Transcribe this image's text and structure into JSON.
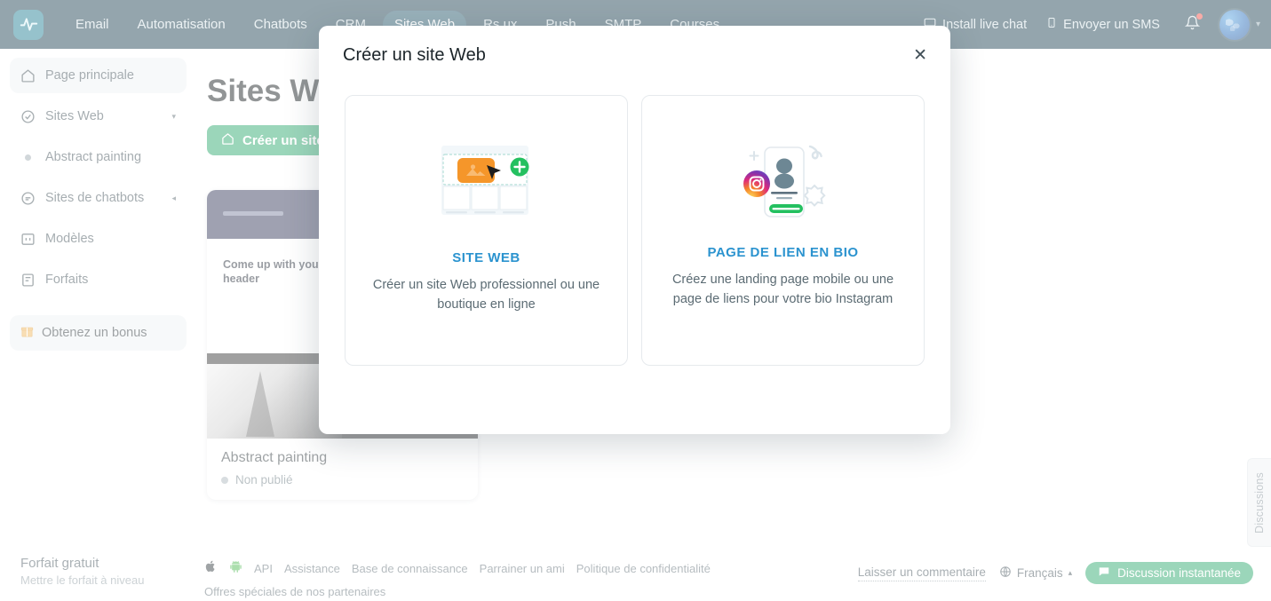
{
  "topnav": {
    "logo_icon": "activity-pulse-logo",
    "items": [
      {
        "label": "Email",
        "active": false
      },
      {
        "label": "Automatisation",
        "active": false
      },
      {
        "label": "Chatbots",
        "active": false
      },
      {
        "label": "CRM",
        "active": false
      },
      {
        "label": "Sites Web",
        "active": true
      },
      {
        "label": "Rs ux",
        "active": false
      },
      {
        "label": "Push",
        "active": false
      },
      {
        "label": "SMTP",
        "active": false
      },
      {
        "label": "Courses",
        "active": false
      }
    ],
    "install_live_chat": "Install live chat",
    "send_sms": "Envoyer un SMS",
    "bell_icon": "notification-bell-icon",
    "avatar_icon": "user-avatar",
    "caret": "▾"
  },
  "sidebar": {
    "items": [
      {
        "label": "Page principale",
        "icon": "home-icon",
        "active": true,
        "caret": ""
      },
      {
        "label": "Sites Web",
        "icon": "check-badge-icon",
        "active": false,
        "caret": "▾"
      },
      {
        "label": "Abstract painting",
        "icon": "dot-icon",
        "active": false,
        "caret": ""
      },
      {
        "label": "Sites de chatbots",
        "icon": "chat-bubble-icon",
        "active": false,
        "caret": "◂"
      },
      {
        "label": "Modèles",
        "icon": "template-icon",
        "active": false,
        "caret": ""
      },
      {
        "label": "Forfaits",
        "icon": "plans-icon",
        "active": false,
        "caret": ""
      }
    ],
    "bonus_label": "Obtenez un bonus",
    "bonus_icon": "gift-icon",
    "plan_title": "Forfait gratuit",
    "plan_sub": "Mettre le forfait à niveau"
  },
  "main": {
    "page_title": "Sites Web",
    "create_button": "Créer un site Web",
    "create_button_icon": "home-icon",
    "collapse_icon": "chevron-left-icon",
    "site_card": {
      "thumb_header_text": "Come up with your own header",
      "thumb_photo_title": "Come up",
      "name": "Abstract painting",
      "status": "Non publié"
    }
  },
  "modal": {
    "title": "Créer un site Web",
    "close_icon": "close-icon",
    "options": [
      {
        "title": "SITE WEB",
        "desc": "Créer un site Web professionnel ou une boutique en ligne",
        "illustration": "website-builder-illustration"
      },
      {
        "title": "PAGE DE LIEN EN BIO",
        "desc": "Créez une landing page mobile ou une page de liens pour votre bio Instagram",
        "illustration": "bio-link-page-illustration"
      }
    ]
  },
  "footer": {
    "apple_icon": "apple-icon",
    "android_icon": "android-icon",
    "links": [
      "API",
      "Assistance",
      "Base de connaissance",
      "Parrainer un ami",
      "Politique de confidentialité"
    ],
    "partners": "Offres spéciales de nos partenaires",
    "comment_link": "Laisser un commentaire",
    "language": "Français",
    "language_icon": "globe-icon",
    "language_caret": "▴",
    "chat_button": "Discussion instantanée",
    "chat_button_icon": "chat-icon",
    "discussions_tab": "Discussions"
  },
  "colors": {
    "navbar": "#12394a",
    "nav_active": "#1d5267",
    "accent_green": "#23a566",
    "link_blue": "#2b93cf",
    "orange": "#f5962a"
  }
}
